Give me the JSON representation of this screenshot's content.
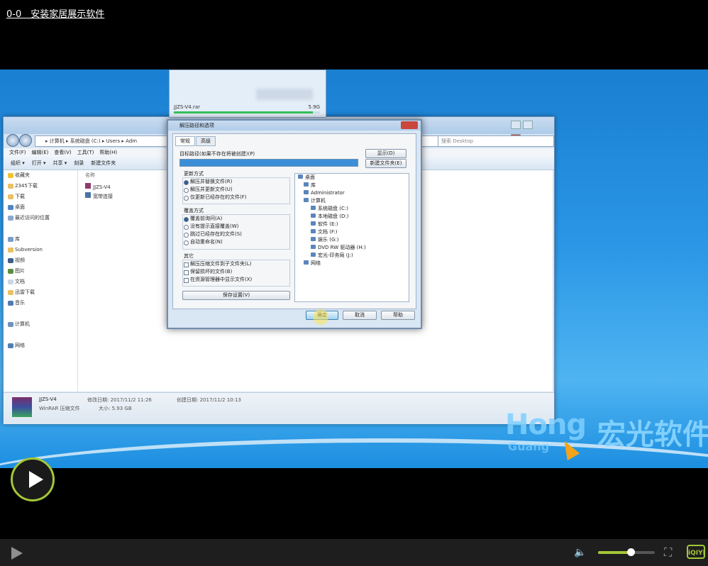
{
  "page_title": "0-0　安装家居展示软件",
  "explorer": {
    "address": "▸ 计算机 ▸ 系统磁盘 (C:) ▸ Users ▸ Adm",
    "search_placeholder": "搜索 Desktop",
    "menu": [
      "文件(F)",
      "编辑(E)",
      "查看(V)",
      "工具(T)",
      "帮助(H)"
    ],
    "toolbar": [
      "组织 ▾",
      "打开 ▾",
      "共享 ▾",
      "刻录",
      "新建文件夹"
    ],
    "nav": [
      {
        "label": "收藏夹",
        "icon": "star-icon"
      },
      {
        "label": "2345下载",
        "icon": "folder-icon"
      },
      {
        "label": "下载",
        "icon": "folder-icon"
      },
      {
        "label": "桌面",
        "icon": "desktop-icon"
      },
      {
        "label": "最近访问的位置",
        "icon": "recent-icon"
      },
      {
        "label": "",
        "icon": ""
      },
      {
        "label": "库",
        "icon": "library-icon"
      },
      {
        "label": "Subversion",
        "icon": "folder-icon"
      },
      {
        "label": "视频",
        "icon": "video-icon"
      },
      {
        "label": "图片",
        "icon": "picture-icon"
      },
      {
        "label": "文档",
        "icon": "document-icon"
      },
      {
        "label": "迅雷下载",
        "icon": "folder-icon"
      },
      {
        "label": "音乐",
        "icon": "music-icon"
      },
      {
        "label": "",
        "icon": ""
      },
      {
        "label": "计算机",
        "icon": "computer-icon"
      },
      {
        "label": "",
        "icon": ""
      },
      {
        "label": "网络",
        "icon": "network-icon"
      }
    ],
    "column_header": "名称",
    "files": [
      "JJZS-V4",
      "宽带连接"
    ],
    "details": {
      "name": "JJZS-V4",
      "type": "WinRAR 压缩文件",
      "modified": "修改日期: 2017/11/2 11:26",
      "size": "大小: 5.93 GB",
      "created": "创建日期: 2017/11/2 10:13"
    }
  },
  "progress_window": {
    "filename": "JJZS-V4.rar",
    "size": "5.9G",
    "progress_fraction": 0.95
  },
  "dialog": {
    "title": "解压路径和选项",
    "tabs": [
      "常规",
      "高级"
    ],
    "path_label": "目标路径(如果不存在将被创建)(P)",
    "buttons_right": [
      "显示(D)",
      "新建文件夹(E)"
    ],
    "update_group_title": "更新方式",
    "update_options": [
      "解压并替换文件(R)",
      "解压并更新文件(U)",
      "仅更新已经存在的文件(F)"
    ],
    "overwrite_group_title": "覆盖方式",
    "overwrite_options": [
      "覆盖前询问(A)",
      "没有提示直接覆盖(W)",
      "跳过已经存在的文件(S)",
      "自动重命名(N)"
    ],
    "misc_group_title": "其它",
    "misc_options": [
      "解压压缩文件到子文件夹(L)",
      "保留损坏的文件(B)",
      "在资源管理器中显示文件(X)"
    ],
    "save_button": "保存设置(V)",
    "tree": [
      "桌面",
      "库",
      "Administrator",
      "计算机",
      "系统磁盘 (C:)",
      "本地磁盘 (D:)",
      "软件 (E:)",
      "文档 (F:)",
      "娱乐 (G:)",
      "DVD RW 驱动器 (H:)",
      "宏光-印务局 (J:)",
      "网络"
    ],
    "ok": "确定",
    "cancel": "取消",
    "help": "帮助"
  },
  "watermark": {
    "latin": "Hong",
    "latin2": "Guang",
    "chinese": "宏光软件"
  },
  "player": {
    "volume_fraction": 0.55,
    "logo": "iQIYI",
    "accent": "#a4c638"
  }
}
